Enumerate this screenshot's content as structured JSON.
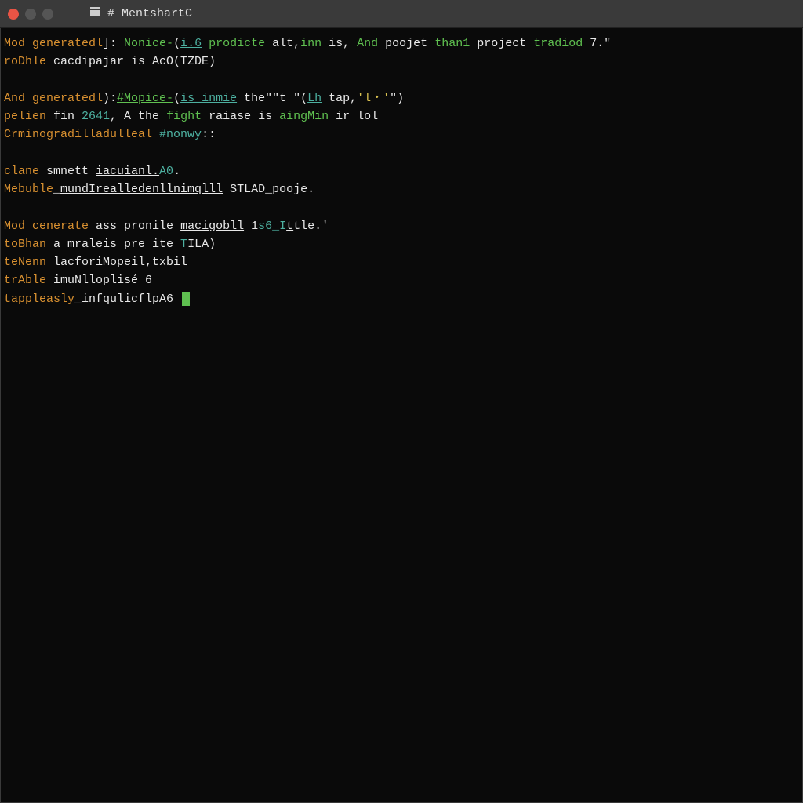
{
  "window": {
    "title": "# MentshartC"
  },
  "lines": [
    {
      "segments": [
        {
          "cls": "orange",
          "text": "Mod generatedl"
        },
        {
          "cls": "white",
          "text": "]:"
        },
        {
          "cls": "green",
          "text": " Nonice-"
        },
        {
          "cls": "white",
          "text": "("
        },
        {
          "cls": "teal underline",
          "text": "i.6"
        },
        {
          "cls": "green",
          "text": " prodicte"
        },
        {
          "cls": "white",
          "text": " alt,"
        },
        {
          "cls": "green",
          "text": "inn"
        },
        {
          "cls": "white",
          "text": " is,"
        },
        {
          "cls": "green",
          "text": " And"
        },
        {
          "cls": "white",
          "text": " poojet "
        },
        {
          "cls": "green",
          "text": "than1"
        },
        {
          "cls": "white",
          "text": " project "
        },
        {
          "cls": "green",
          "text": "tradiod"
        },
        {
          "cls": "white",
          "text": " 7.\""
        }
      ]
    },
    {
      "segments": [
        {
          "cls": "orange",
          "text": "roDhle"
        },
        {
          "cls": "white",
          "text": " cacdipajar is AcO(TZDE)"
        }
      ]
    },
    {
      "blank": true
    },
    {
      "segments": [
        {
          "cls": "orange",
          "text": "And generatedl"
        },
        {
          "cls": "white",
          "text": "):"
        },
        {
          "cls": "green underline",
          "text": "#Mopice-"
        },
        {
          "cls": "white",
          "text": "("
        },
        {
          "cls": "teal underline",
          "text": "is_inmie"
        },
        {
          "cls": "white",
          "text": " the\"\"t \"("
        },
        {
          "cls": "teal underline",
          "text": "Lh"
        },
        {
          "cls": "white",
          "text": " tap,"
        },
        {
          "cls": "yellow",
          "text": "'l・'"
        },
        {
          "cls": "white",
          "text": "\")"
        }
      ]
    },
    {
      "segments": [
        {
          "cls": "orange",
          "text": "pelien"
        },
        {
          "cls": "white",
          "text": " fin "
        },
        {
          "cls": "teal",
          "text": "2641"
        },
        {
          "cls": "white",
          "text": ", A the "
        },
        {
          "cls": "green",
          "text": "fight"
        },
        {
          "cls": "white",
          "text": " raiase is "
        },
        {
          "cls": "green",
          "text": "aingMin"
        },
        {
          "cls": "white",
          "text": " ir lol"
        }
      ]
    },
    {
      "segments": [
        {
          "cls": "orange",
          "text": "Crminogradilladulleal"
        },
        {
          "cls": "white",
          "text": " "
        },
        {
          "cls": "teal",
          "text": "#nonwy"
        },
        {
          "cls": "white",
          "text": "::"
        }
      ]
    },
    {
      "blank": true
    },
    {
      "segments": [
        {
          "cls": "orange",
          "text": "clane"
        },
        {
          "cls": "white",
          "text": " smnett "
        },
        {
          "cls": "white underline",
          "text": "iacuianl."
        },
        {
          "cls": "teal",
          "text": "A0"
        },
        {
          "cls": "white",
          "text": "."
        }
      ]
    },
    {
      "segments": [
        {
          "cls": "orange",
          "text": "Mebuble"
        },
        {
          "cls": "white",
          "text": "_"
        },
        {
          "cls": "white underline",
          "text": "mundIrealledenllnimqlll"
        },
        {
          "cls": "white",
          "text": " STLAD_pooje."
        }
      ]
    },
    {
      "blank": true
    },
    {
      "segments": [
        {
          "cls": "orange",
          "text": "Mod cenerate"
        },
        {
          "cls": "white",
          "text": " ass pronile "
        },
        {
          "cls": "white underline",
          "text": "macigobll"
        },
        {
          "cls": "white",
          "text": " 1"
        },
        {
          "cls": "teal",
          "text": "s6_I"
        },
        {
          "cls": "white underline",
          "text": "t"
        },
        {
          "cls": "white",
          "text": "tle.'"
        }
      ]
    },
    {
      "segments": [
        {
          "cls": "orange",
          "text": "toBhan"
        },
        {
          "cls": "white",
          "text": " a mraleis pre ite "
        },
        {
          "cls": "teal",
          "text": "T"
        },
        {
          "cls": "white",
          "text": "ILA)"
        }
      ]
    },
    {
      "segments": [
        {
          "cls": "orange",
          "text": "teNenn"
        },
        {
          "cls": "white",
          "text": " lacforiMopeil,txbil"
        }
      ]
    },
    {
      "segments": [
        {
          "cls": "orange",
          "text": "trAble"
        },
        {
          "cls": "white",
          "text": " imuNlloplisé 6"
        }
      ]
    },
    {
      "segments": [
        {
          "cls": "orange",
          "text": "tappleasly"
        },
        {
          "cls": "white",
          "text": "_infqulicflpA6 "
        }
      ],
      "cursor": true
    }
  ]
}
